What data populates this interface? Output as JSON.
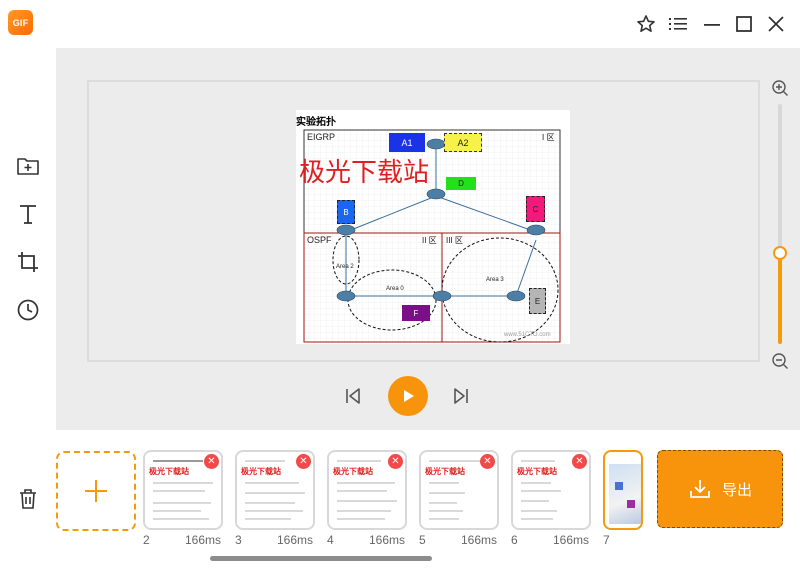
{
  "app": {
    "logo_text": "GIF"
  },
  "title_bar": {
    "icons": [
      "star-icon",
      "list-icon",
      "minimize-icon",
      "maximize-icon",
      "close-icon"
    ]
  },
  "left_toolbar": {
    "tools": [
      "add-folder-icon",
      "text-icon",
      "crop-icon",
      "clock-icon"
    ]
  },
  "preview": {
    "title": "实验拓扑",
    "watermark": "极光下载站",
    "regions": {
      "eigrp": "EIGRP",
      "area1": "I 区",
      "ospf": "OSPF",
      "area2": "II 区",
      "area3": "III 区",
      "area0": "Area 0",
      "area2_label": "Area 2",
      "area3_label": "Area 3"
    },
    "nodes": {
      "a1": "A1",
      "a2": "A2",
      "d": "D",
      "b": "B",
      "c": "C",
      "e": "E",
      "f": "F"
    },
    "site_mark": "www.51CTO.com",
    "colors": {
      "a1": "#1a33e8",
      "a2": "#f7f24a",
      "d": "#22e01a",
      "b": "#1a66f0",
      "c": "#f01a7a",
      "e": "#b5b5b5",
      "f": "#7a0f88"
    }
  },
  "zoom": {
    "level": 0.38
  },
  "playback": {
    "prev": "skip-back-icon",
    "play": "play-icon",
    "next": "skip-forward-icon"
  },
  "frames": [
    {
      "index": "2",
      "duration": "166ms",
      "title": "极光下载站"
    },
    {
      "index": "3",
      "duration": "166ms",
      "title": "极光下载站"
    },
    {
      "index": "4",
      "duration": "166ms",
      "title": "极光下载站"
    },
    {
      "index": "5",
      "duration": "166ms",
      "title": "极光下载站"
    },
    {
      "index": "6",
      "duration": "166ms",
      "title": "极光下载站"
    },
    {
      "index": "7",
      "duration": "",
      "title": ""
    }
  ],
  "export": {
    "label": "导出"
  },
  "colors": {
    "accent": "#f8940c",
    "delete": "#f24a4a",
    "watermark": "#e02020"
  }
}
